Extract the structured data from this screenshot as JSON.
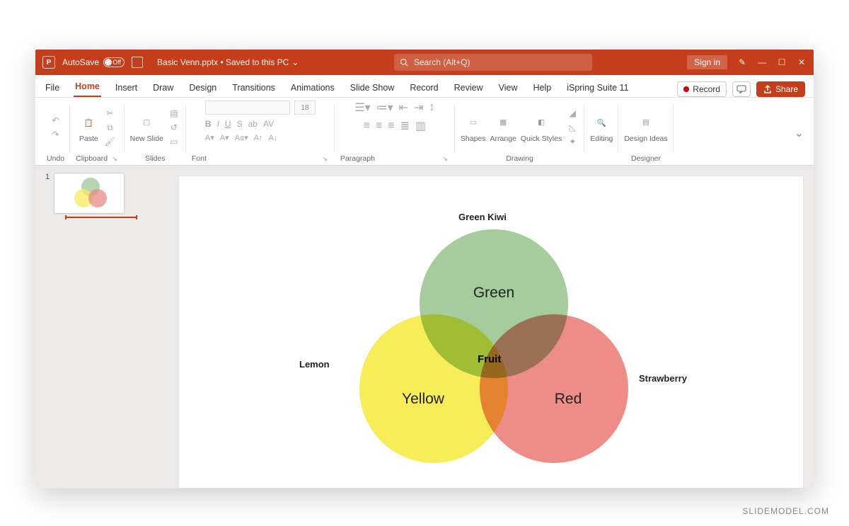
{
  "titlebar": {
    "autosave_label": "AutoSave",
    "autosave_state": "Off",
    "document_title": "Basic Venn.pptx • Saved to this PC",
    "search_placeholder": "Search (Alt+Q)",
    "sign_in": "Sign in"
  },
  "tabs": {
    "items": [
      "File",
      "Home",
      "Insert",
      "Draw",
      "Design",
      "Transitions",
      "Animations",
      "Slide Show",
      "Record",
      "Review",
      "View",
      "Help",
      "iSpring Suite 11"
    ],
    "active": "Home",
    "record_button": "Record",
    "share_button": "Share"
  },
  "ribbon": {
    "groups": {
      "undo": "Undo",
      "clipboard": "Clipboard",
      "paste": "Paste",
      "slides": "Slides",
      "new_slide": "New Slide",
      "font": "Font",
      "font_size": "18",
      "paragraph": "Paragraph",
      "drawing": "Drawing",
      "shapes": "Shapes",
      "arrange": "Arrange",
      "quick_styles": "Quick Styles",
      "editing": "Editing",
      "designer": "Designer",
      "design_ideas": "Design Ideas"
    }
  },
  "thumbs": {
    "slide_number": "1"
  },
  "venn": {
    "top_label": "Green Kiwi",
    "left_label": "Lemon",
    "right_label": "Strawberry",
    "circle_green": "Green",
    "circle_yellow": "Yellow",
    "circle_red": "Red",
    "center": "Fruit"
  },
  "watermark": "SLIDEMODEL.COM",
  "chart_data": {
    "type": "venn",
    "sets": [
      {
        "name": "Green",
        "label": "Green Kiwi",
        "color": "#96c38c"
      },
      {
        "name": "Yellow",
        "label": "Lemon",
        "color": "#f5eb46"
      },
      {
        "name": "Red",
        "label": "Strawberry",
        "color": "#eb7873"
      }
    ],
    "intersection_label": "Fruit"
  }
}
